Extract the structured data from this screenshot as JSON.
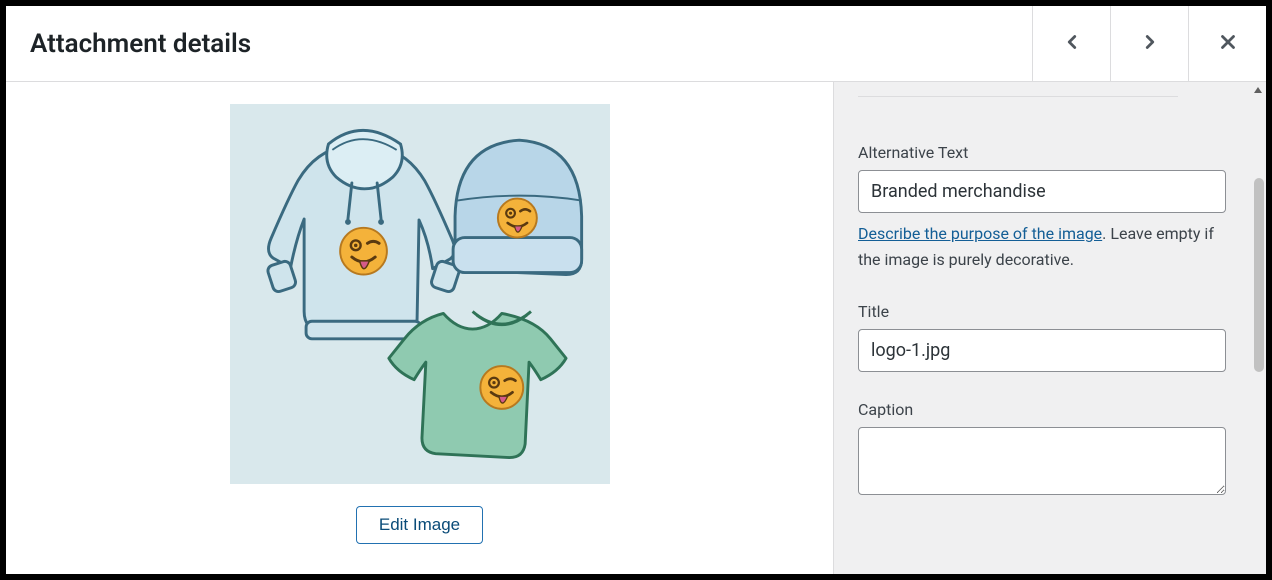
{
  "header": {
    "title": "Attachment details"
  },
  "actions": {
    "edit_image": "Edit Image"
  },
  "fields": {
    "alt_label": "Alternative Text",
    "alt_value": "Branded merchandise",
    "alt_help_link": "Describe the purpose of the image",
    "alt_help_rest": ". Leave empty if the image is purely decorative.",
    "title_label": "Title",
    "title_value": "logo-1.jpg",
    "caption_label": "Caption",
    "caption_value": ""
  },
  "illustration": {
    "name": "branded-merchandise-illustration"
  }
}
